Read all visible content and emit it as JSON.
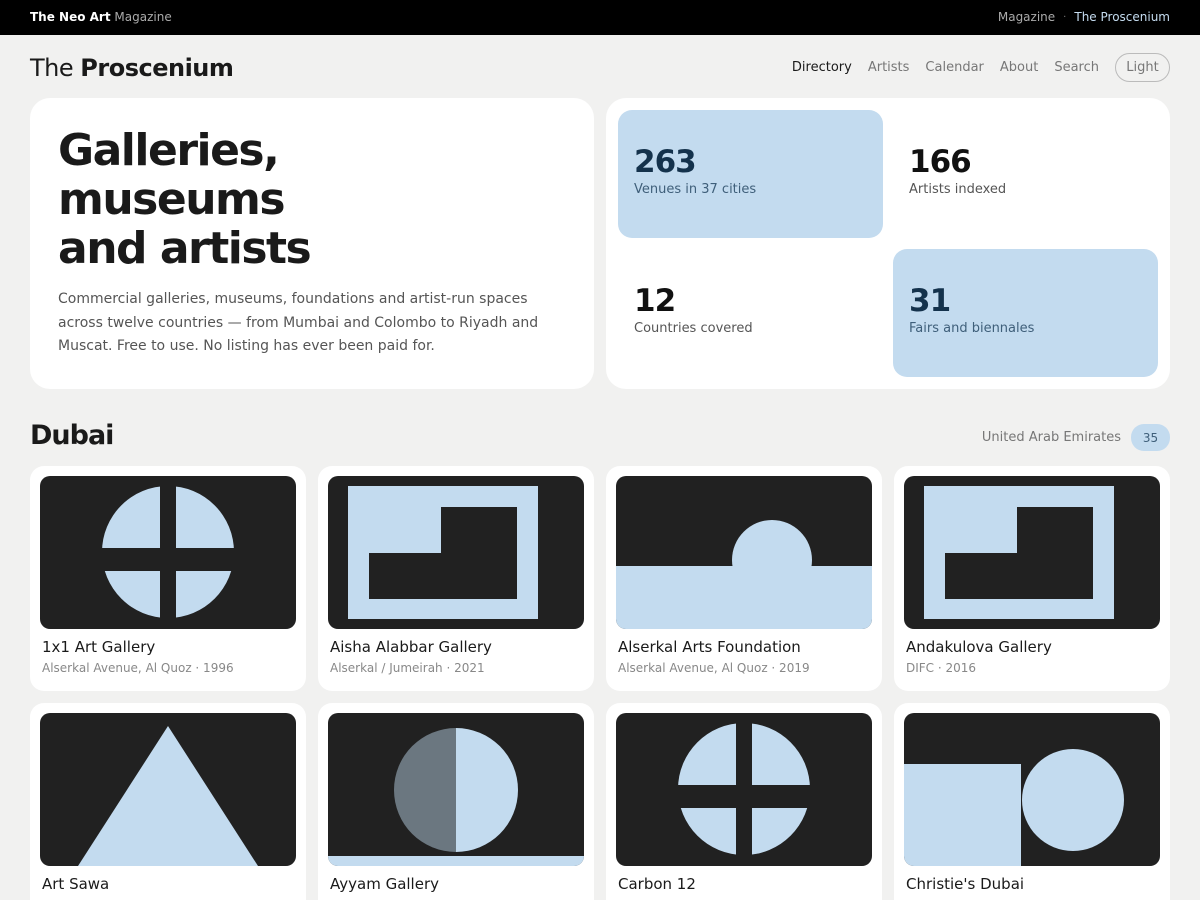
{
  "topbar": {
    "brand_bold": "The Neo Art",
    "brand_sub": "Magazine",
    "link_magazine": "Magazine",
    "separator": "·",
    "link_current": "The Proscenium"
  },
  "site": {
    "title_light": "The",
    "title_bold": "Proscenium"
  },
  "nav": {
    "items": [
      "Directory",
      "Artists",
      "Calendar",
      "About",
      "Search"
    ],
    "active": "Directory",
    "theme_label": "Light"
  },
  "hero": {
    "heading_lines": [
      "Galleries,",
      "museums",
      "and artists"
    ],
    "description": "Commercial galleries, museums, foundations and artist-run spaces across twelve countries — from Mumbai and Colombo to Riyadh and Muscat. Free to use. No listing has ever been paid for."
  },
  "stats": [
    {
      "value": "263",
      "label": "Venues in 37 cities",
      "highlight": true
    },
    {
      "value": "166",
      "label": "Artists indexed",
      "highlight": false
    },
    {
      "value": "12",
      "label": "Countries covered",
      "highlight": false
    },
    {
      "value": "31",
      "label": "Fairs and biennales",
      "highlight": true
    }
  ],
  "section": {
    "city": "Dubai",
    "country": "United Arab Emirates",
    "count": "35"
  },
  "colors": {
    "accent": "#c3dbef",
    "tile": "#212121",
    "dark_accent": "#14324c",
    "grey_half": "#6b7780"
  },
  "venues": [
    {
      "name": "1x1 Art Gallery",
      "meta": "Alserkal Avenue, Al Quoz · 1996",
      "pattern": "quartered-circle"
    },
    {
      "name": "Aisha Alabbar Gallery",
      "meta": "Alserkal / Jumeirah · 2021",
      "pattern": "frame-step"
    },
    {
      "name": "Alserkal Arts Foundation",
      "meta": "Alserkal Avenue, Al Quoz · 2019",
      "pattern": "sunrise"
    },
    {
      "name": "Andakulova Gallery",
      "meta": "DIFC · 2016",
      "pattern": "frame-step"
    },
    {
      "name": "Art Sawa",
      "meta": "",
      "pattern": "triangle"
    },
    {
      "name": "Ayyam Gallery",
      "meta": "",
      "pattern": "half-circle"
    },
    {
      "name": "Carbon 12",
      "meta": "",
      "pattern": "quartered-circle"
    },
    {
      "name": "Christie's Dubai",
      "meta": "",
      "pattern": "square-circle"
    }
  ]
}
